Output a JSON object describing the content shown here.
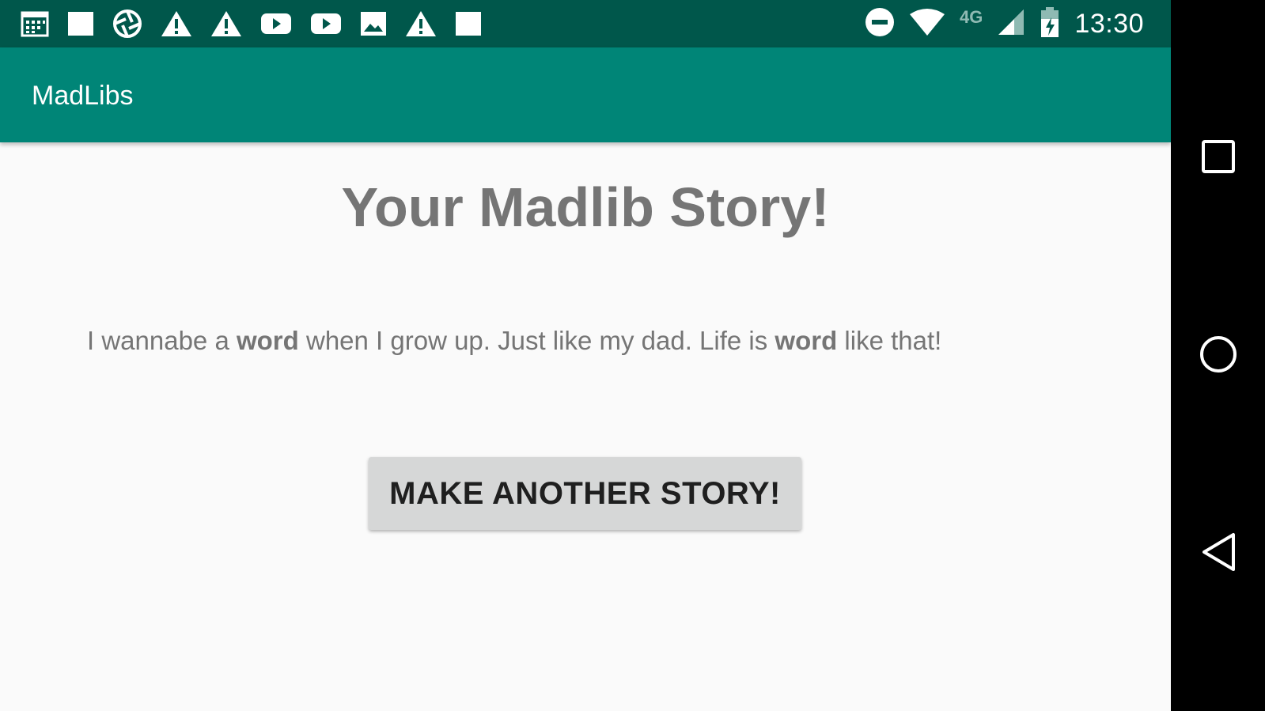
{
  "status_bar": {
    "time": "13:30",
    "network": "4G",
    "notification_icons": [
      "calendar-icon",
      "square-icon",
      "aperture-icon",
      "warning-icon",
      "warning-icon",
      "youtube-icon",
      "youtube-icon",
      "image-icon",
      "warning-icon",
      "square-icon"
    ],
    "system_icons": [
      "do-not-disturb-icon",
      "wifi-icon",
      "cell-signal-icon",
      "battery-charging-icon"
    ]
  },
  "app_bar": {
    "title": "MadLibs"
  },
  "main": {
    "heading": "Your Madlib Story!",
    "story": {
      "part1": "I wannabe a ",
      "word1": "word",
      "part2": " when I grow up. Just like my dad. Life is ",
      "word2": "word",
      "part3": " like that!"
    },
    "button_label": "MAKE ANOTHER STORY!"
  },
  "nav_bar": {
    "buttons": [
      "recents-icon",
      "home-icon",
      "back-icon"
    ]
  },
  "colors": {
    "status_bar": "#00574b",
    "app_bar": "#008577",
    "background": "#fafafa",
    "text_gray": "#757575",
    "button_bg": "#d6d7d7"
  }
}
